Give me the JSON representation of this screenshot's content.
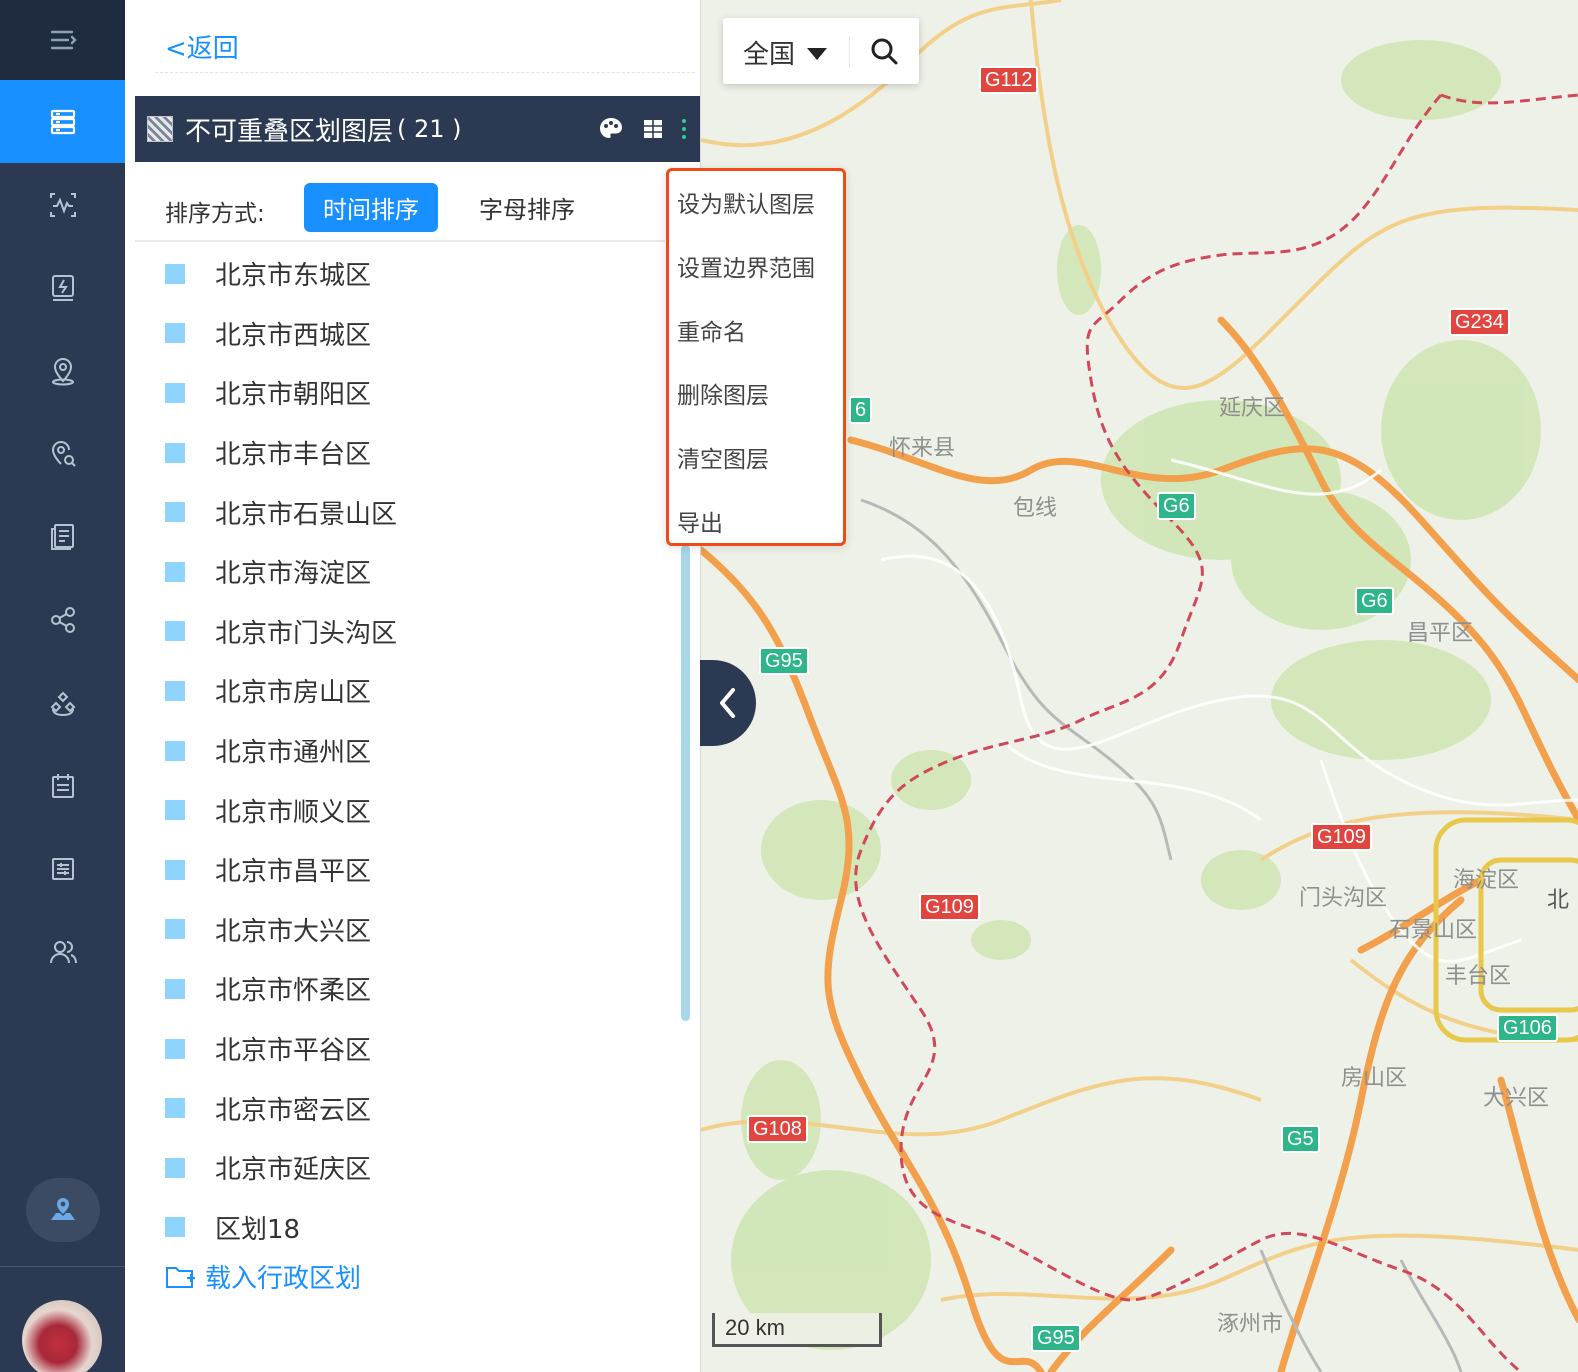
{
  "nav": {
    "items": [
      {
        "name": "data-layer-icon",
        "active": true
      },
      {
        "name": "waveform-icon",
        "active": false
      },
      {
        "name": "lightning-doc-icon",
        "active": false
      },
      {
        "name": "map-pin-icon",
        "active": false
      },
      {
        "name": "pin-search-icon",
        "active": false
      },
      {
        "name": "report-icon",
        "active": false
      },
      {
        "name": "share-icon",
        "active": false
      },
      {
        "name": "cluster-icon",
        "active": false
      },
      {
        "name": "calendar-icon",
        "active": false
      },
      {
        "name": "task-list-icon",
        "active": false
      },
      {
        "name": "users-icon",
        "active": false
      }
    ],
    "active_color": "#1890ff",
    "bg_color": "#2b3a52"
  },
  "panel": {
    "back_label": "<返回",
    "layer_title": "不可重叠区划图层",
    "layer_count": "( 21 )",
    "sort_label": "排序方式:",
    "sort_time": "时间排序",
    "sort_alpha": "字母排序",
    "regions": [
      "北京市东城区",
      "北京市西城区",
      "北京市朝阳区",
      "北京市丰台区",
      "北京市石景山区",
      "北京市海淀区",
      "北京市门头沟区",
      "北京市房山区",
      "北京市通州区",
      "北京市顺义区",
      "北京市昌平区",
      "北京市大兴区",
      "北京市怀柔区",
      "北京市平谷区",
      "北京市密云区",
      "北京市延庆区",
      "区划18"
    ],
    "load_label": "载入行政区划"
  },
  "map": {
    "region_select": "全国",
    "scale": "20 km",
    "road_shields": [
      {
        "text": "G112",
        "type": "red"
      },
      {
        "text": "G234",
        "type": "red"
      },
      {
        "text": "6",
        "type": "green"
      },
      {
        "text": "G6",
        "type": "green"
      },
      {
        "text": "G6",
        "type": "green"
      },
      {
        "text": "G95",
        "type": "green"
      },
      {
        "text": "G109",
        "type": "red"
      },
      {
        "text": "G109",
        "type": "red"
      },
      {
        "text": "G108",
        "type": "red"
      },
      {
        "text": "G5",
        "type": "green"
      },
      {
        "text": "G95",
        "type": "green"
      },
      {
        "text": "G106",
        "type": "green"
      }
    ],
    "place_labels": [
      "怀来县",
      "延庆区",
      "包线",
      "昌平区",
      "门头沟区",
      "海淀区",
      "石景山区",
      "丰台区",
      "房山区",
      "大兴区",
      "涿州市",
      "北"
    ]
  },
  "context_menu": {
    "items": [
      "设为默认图层",
      "设置边界范围",
      "重命名",
      "删除图层",
      "清空图层",
      "导出"
    ],
    "border_color": "#f04a16"
  }
}
